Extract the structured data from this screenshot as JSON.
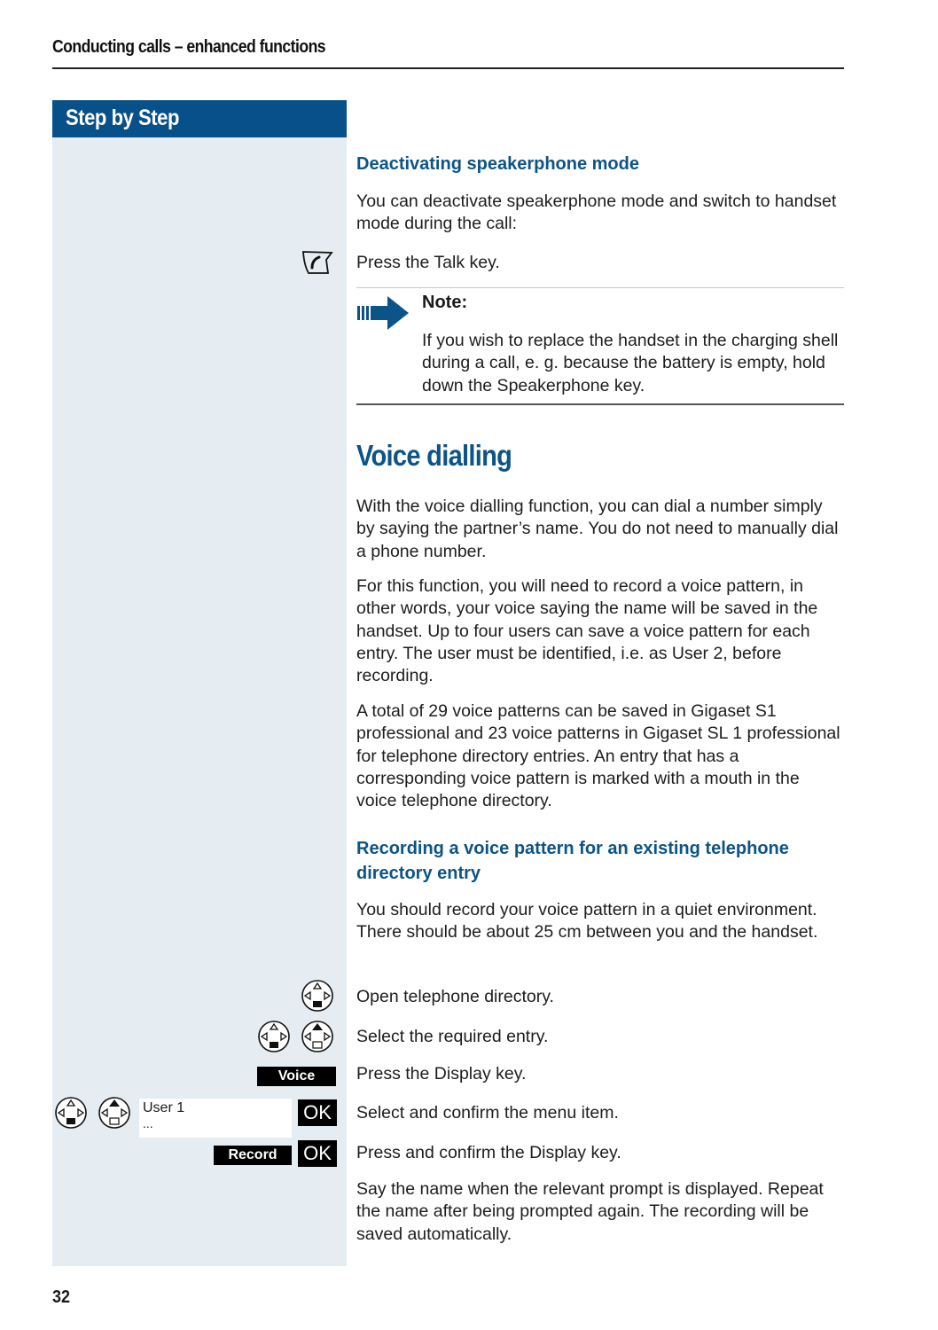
{
  "header": {
    "running_title": "Conducting calls – enhanced functions"
  },
  "sidebar": {
    "title": "Step by Step"
  },
  "footer": {
    "page_number": "32"
  },
  "sections": {
    "deactivating": {
      "heading": "Deactivating speakerphone mode",
      "intro": "You can deactivate speakerphone mode and switch to handset mode during the call:",
      "step_talk": "Press the Talk key."
    },
    "note": {
      "label": "Note:",
      "text": "If you wish to replace the handset in the charging shell during a call, e. g. because the battery is empty, hold down the Speakerphone key."
    },
    "voice_dialling": {
      "heading": "Voice dialling",
      "p1": "With the voice dialling function, you can dial a number simply by saying the partner’s name. You do not need to manually dial a phone number.",
      "p2": "For this function, you will need to record a voice pattern, in other words, your voice saying the name will be saved in the handset. Up to four users can save a voice pattern for each entry. The user must be identified, i.e. as User 2, before recording.",
      "p3": "A total of 29 voice patterns can be saved in Gigaset S1 professional and 23 voice patterns in Gigaset SL 1 professional for telephone directory entries. An entry that has a corresponding voice pattern is marked with a mouth in the voice telephone directory."
    },
    "recording": {
      "heading": "Recording a voice pattern for an existing telephone directory entry",
      "intro": "You should record your voice pattern in a quiet environment. There should be about 25 cm between you and the handset.",
      "steps": [
        "Open telephone directory.",
        "Select the required entry.",
        "Press the Display key.",
        "Select and confirm the menu item.",
        "Press and confirm the Display key."
      ],
      "outro": "Say the name when the relevant prompt is displayed. Repeat the name after being prompted again. The recording will be saved automatically."
    }
  },
  "keys": {
    "voice": "Voice",
    "record": "Record",
    "ok": "OK",
    "display_line1": "User 1",
    "display_line2": "..."
  },
  "colors": {
    "accent": "#07508a",
    "sidebar_bg": "#e6edf2"
  }
}
